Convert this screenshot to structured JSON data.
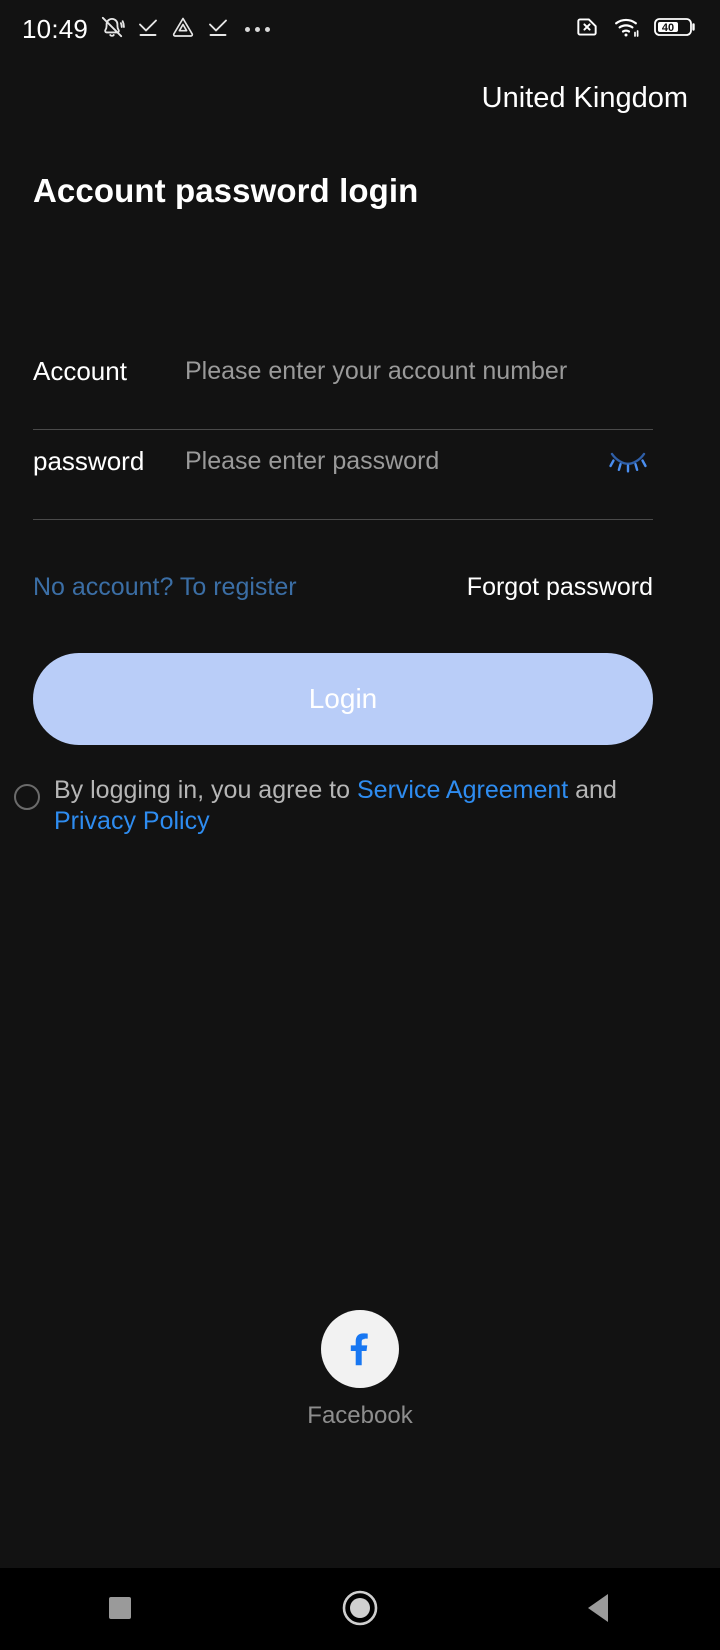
{
  "statusbar": {
    "time": "10:49",
    "left_icons": [
      "bell-muted-icon",
      "check-download-icon",
      "drive-triangle-icon",
      "check-download-icon",
      "more-dots-icon"
    ],
    "right_icons": [
      "sim-disabled-icon",
      "wifi-icon",
      "battery-icon"
    ],
    "battery_level": "40"
  },
  "header": {
    "country": "United Kingdom"
  },
  "page_title": "Account password login",
  "form": {
    "account": {
      "label": "Account",
      "value": "",
      "placeholder": "Please enter your account number"
    },
    "password": {
      "label": "password",
      "value": "",
      "placeholder": "Please enter password",
      "toggle_icon": "eye-closed-icon"
    }
  },
  "links": {
    "register": "No account? To register",
    "forgot": "Forgot password"
  },
  "login_button": {
    "label": "Login"
  },
  "agreement": {
    "checked": false,
    "prefix": "By logging in, you agree to ",
    "service_agreement": "Service Agreement",
    "conjunction": " and ",
    "privacy_policy": "Privacy Policy"
  },
  "social": {
    "facebook_label": "Facebook",
    "facebook_icon": "facebook-icon"
  },
  "navbar": {
    "recents": "square-recents-icon",
    "home": "circle-home-icon",
    "back": "triangle-back-icon"
  },
  "colors": {
    "background": "#121212",
    "accent_blue": "#2e8cf0",
    "muted_blue": "#3b6ea5",
    "login_button": "#b9cdf8",
    "placeholder": "#9a9a9a",
    "divider": "#4a4a4a",
    "facebook_blue": "#1877f2"
  }
}
